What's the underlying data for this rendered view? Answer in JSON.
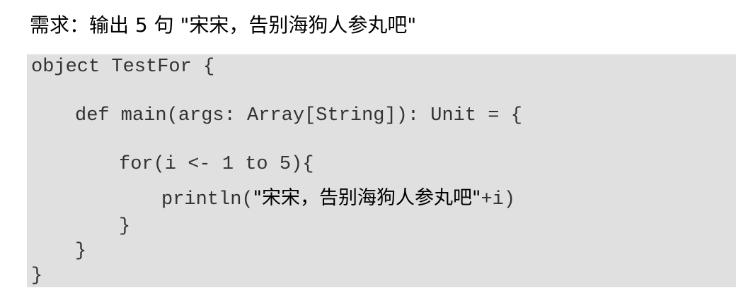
{
  "heading": "需求：输出 5 句 \"宋宋，告别海狗人参丸吧\"",
  "code": {
    "line1": "object TestFor {",
    "line2": "def main(args: Array[String]): Unit = {",
    "line3": "for(i <- 1 to 5){",
    "line4_prefix": "println(",
    "line4_string": "\"宋宋，告别海狗人参丸吧\"",
    "line4_suffix": "+i)",
    "line5": "}",
    "line6": "}",
    "line7": "}"
  }
}
